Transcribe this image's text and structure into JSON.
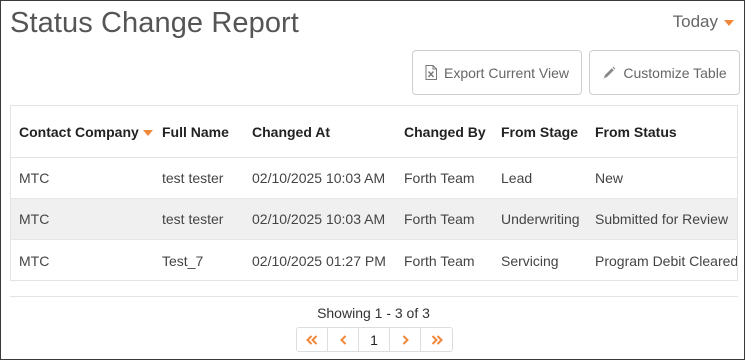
{
  "header": {
    "title": "Status Change Report",
    "period_label": "Today"
  },
  "toolbar": {
    "export_label": "Export Current View",
    "customize_label": "Customize Table"
  },
  "table": {
    "columns": [
      "Contact Company",
      "Full Name",
      "Changed At",
      "Changed By",
      "From Stage",
      "From Status"
    ],
    "sorted_column": "Contact Company",
    "rows": [
      [
        "MTC",
        "test tester",
        "02/10/2025 10:03 AM",
        "Forth Team",
        "Lead",
        "New"
      ],
      [
        "MTC",
        "test tester",
        "02/10/2025 10:03 AM",
        "Forth Team",
        "Underwriting",
        "Submitted for Review"
      ],
      [
        "MTC",
        "Test_7",
        "02/10/2025 01:27 PM",
        "Forth Team",
        "Servicing",
        "Program Debit Cleared"
      ]
    ]
  },
  "footer": {
    "showing_text": "Showing 1 - 3 of 3",
    "current_page": "1"
  },
  "colors": {
    "accent": "#f0883b",
    "row_alt": "#f0f0f0",
    "border": "#e3e3e3"
  },
  "icons": {
    "export": "excel-file-icon",
    "customize": "pencil-icon",
    "first": "double-chevron-left-icon",
    "prev": "chevron-left-icon",
    "next": "chevron-right-icon",
    "last": "double-chevron-right-icon"
  }
}
